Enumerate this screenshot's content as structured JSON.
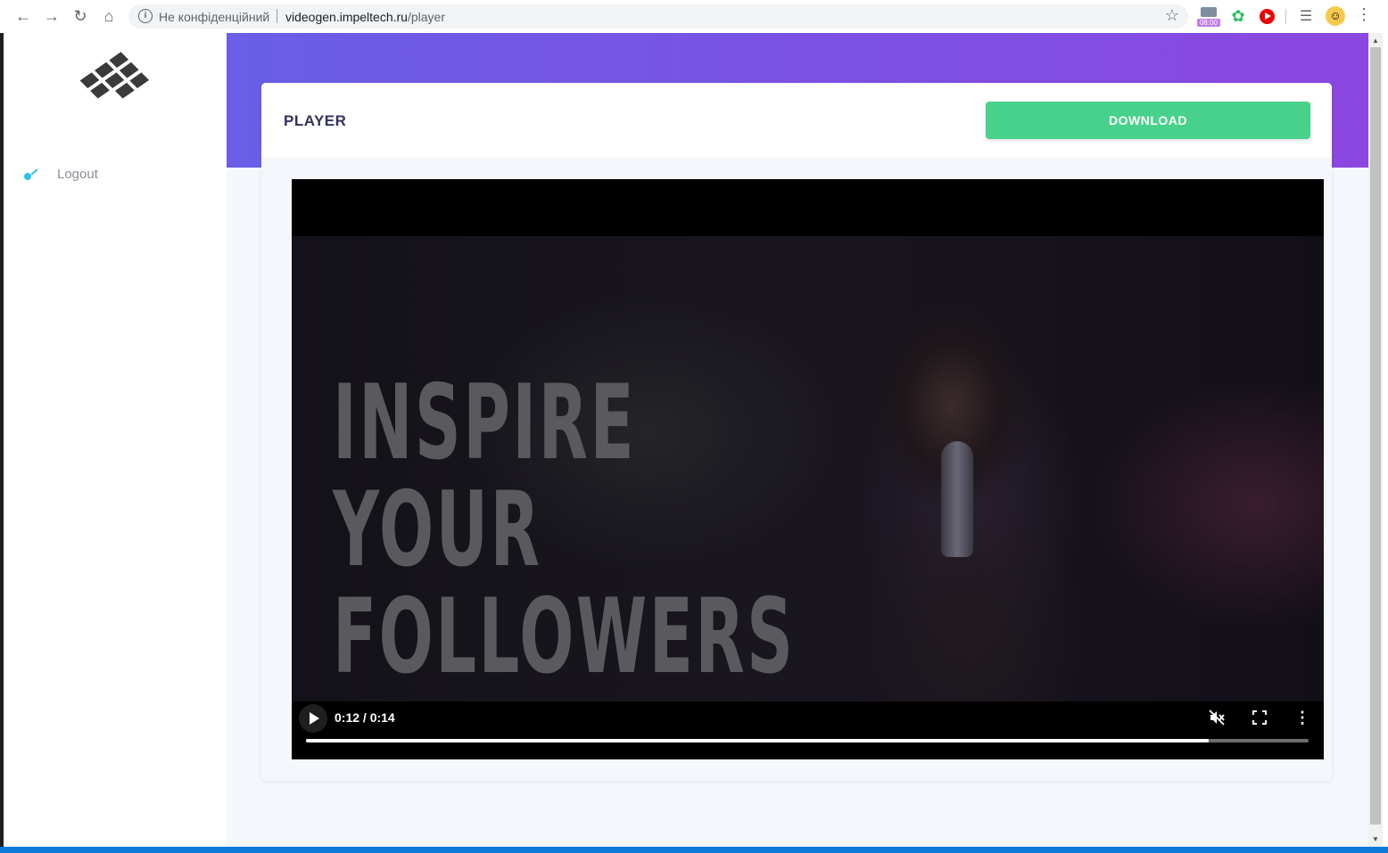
{
  "browser": {
    "not_secure_label": "Не конфіденційний",
    "url_domain": "videogen.impeltech.ru",
    "url_path": "/player",
    "clock_badge": "08:00"
  },
  "sidebar": {
    "logout_label": "Logout"
  },
  "page": {
    "title": "PLAYER",
    "download_label": "DOWNLOAD"
  },
  "video": {
    "headline": [
      "INSPIRE",
      "YOUR",
      "FOLLOWERS"
    ],
    "time": "0:12 / 0:14",
    "progress": 0.9
  },
  "colors": {
    "accent_gradient_start": "#6a5fe6",
    "accent_gradient_end": "#8b47e0",
    "download_button": "#47d18b",
    "logout_icon": "#2dc2e8"
  }
}
